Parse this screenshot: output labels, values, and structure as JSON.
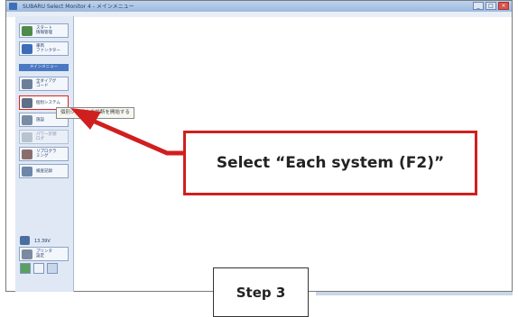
{
  "window": {
    "title": "SUBARU Select Monitor 4 - メインメニュー"
  },
  "sidebar": {
    "top_buttons": [
      {
        "label": "スタート\n情報管理",
        "icon": "car-icon"
      },
      {
        "label": "車両\nファンクター",
        "icon": "network-icon"
      }
    ],
    "main_menu_title": "メインメニュー",
    "menu_buttons": [
      {
        "label": "全ダイアグ\nコード",
        "icon": "diagnostic-icon"
      },
      {
        "label": "個別システム",
        "icon": "system-icon"
      },
      {
        "label": "施設",
        "icon": "facility-icon"
      },
      {
        "label": "パワー計測\nログ",
        "icon": "power-icon"
      },
      {
        "label": "リプログラ\nミング",
        "icon": "reprogram-icon"
      },
      {
        "label": "検査記録",
        "icon": "record-icon"
      }
    ],
    "voltage": "13.39V",
    "bottom_button_label": "プリンタ\n設定",
    "bottom_icons": [
      "settings-icon",
      "save-icon",
      "home-icon"
    ]
  },
  "tooltip": {
    "text": "個別システムの診断を開始する"
  },
  "callout": {
    "text": "Select “Each system (F2)”",
    "color": "#d01f1f"
  },
  "step": {
    "label": "Step 3"
  }
}
